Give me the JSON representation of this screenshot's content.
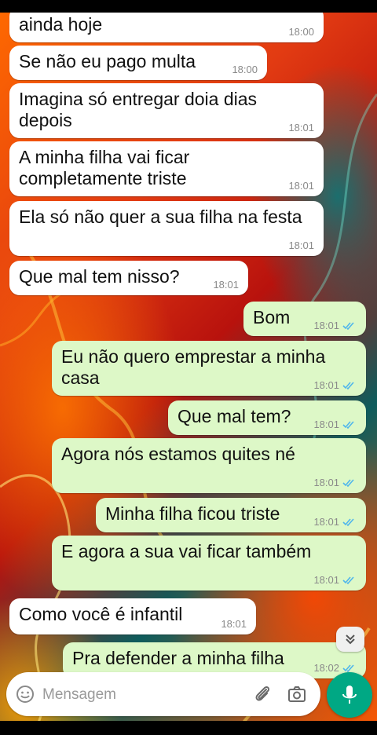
{
  "colors": {
    "incoming_bubble": "#ffffff",
    "outgoing_bubble": "#ddf8c7",
    "timestamp": "#8a8a8a",
    "read_ticks": "#4fb6ec",
    "mic_button": "#00a884"
  },
  "messages": [
    {
      "direction": "in",
      "text": "ainda hoje",
      "time": "18:00"
    },
    {
      "direction": "in",
      "text": "Se não eu pago multa",
      "time": "18:00"
    },
    {
      "direction": "in",
      "text": "Imagina só entregar doia dias depois",
      "time": "18:01"
    },
    {
      "direction": "in",
      "text": "A minha filha vai ficar completamente triste",
      "time": "18:01"
    },
    {
      "direction": "in",
      "text": "Ela só não quer a sua filha na festa",
      "time": "18:01"
    },
    {
      "direction": "in",
      "text": "Que mal tem nisso?",
      "time": "18:01"
    },
    {
      "direction": "out",
      "text": "Bom",
      "time": "18:01",
      "status_icon": "double-check-icon"
    },
    {
      "direction": "out",
      "text": "Eu não quero emprestar a minha casa",
      "time": "18:01",
      "status_icon": "double-check-icon"
    },
    {
      "direction": "out",
      "text": "Que mal tem?",
      "time": "18:01",
      "status_icon": "double-check-icon"
    },
    {
      "direction": "out",
      "text": "Agora nós estamos quites né",
      "time": "18:01",
      "status_icon": "double-check-icon"
    },
    {
      "direction": "out",
      "text": "Minha filha ficou triste",
      "time": "18:01",
      "status_icon": "double-check-icon"
    },
    {
      "direction": "out",
      "text": "E agora a sua vai ficar também",
      "time": "18:01",
      "status_icon": "double-check-icon"
    },
    {
      "direction": "in",
      "text": "Como você é infantil",
      "time": "18:01"
    },
    {
      "direction": "out",
      "text": "Pra defender a minha filha",
      "time": "18:02",
      "status_icon": "double-check-icon"
    }
  ],
  "scroll_down": {
    "icon": "double-chevron-down-icon"
  },
  "composer": {
    "placeholder": "Mensagem",
    "emoji_icon": "emoji-icon",
    "attach_icon": "paperclip-icon",
    "camera_icon": "camera-icon",
    "mic_icon": "mic-icon"
  }
}
